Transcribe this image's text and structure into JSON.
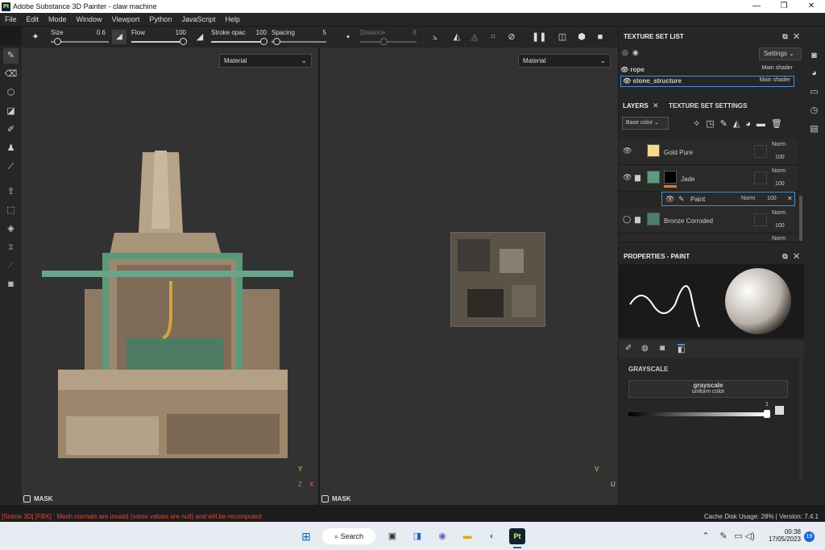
{
  "window": {
    "app_badge": "Pt",
    "title": "Adobe Substance 3D Painter - claw machine",
    "controls": [
      "—",
      "❐",
      "✕"
    ]
  },
  "menu": [
    "File",
    "Edit",
    "Mode",
    "Window",
    "Viewport",
    "Python",
    "JavaScript",
    "Help"
  ],
  "toolbar": {
    "size_label": "Size",
    "size_value": "0.6",
    "flow_label": "Flow",
    "flow_value": "100",
    "stroke_label": "Stroke opac",
    "stroke_value": "100",
    "spacing_label": "Spacing",
    "spacing_value": "5",
    "distance_label": "Distance",
    "distance_value": "8"
  },
  "viewport_3d": {
    "material_select": "Material",
    "mask_label": "MASK",
    "axis_y": "Y",
    "axis_x": "X",
    "axis_z": "Z"
  },
  "viewport_uv": {
    "material_select": "Material",
    "mask_label": "MASK",
    "axis_v": "V",
    "axis_u": "U"
  },
  "texture_set_list": {
    "title": "TEXTURE SET LIST",
    "settings_label": "Settings",
    "items": [
      {
        "name": "rope",
        "shader": "Main shader"
      },
      {
        "name": "stone_structure",
        "shader": "Main shader"
      }
    ]
  },
  "layers": {
    "tab_layers": "LAYERS",
    "tab_texture_settings": "TEXTURE SET SETTINGS",
    "channel_select": "Base color",
    "rows": [
      {
        "name": "Gold Pure",
        "blend": "Norm",
        "opacity": "100",
        "color": "#f6d98b"
      },
      {
        "name": "Jade",
        "blend": "Norm",
        "opacity": "100",
        "color": "#5b9c7b"
      },
      {
        "name": "Paint",
        "blend": "Norm",
        "opacity": "100"
      },
      {
        "name": "Bronze Corroded",
        "blend": "Norm",
        "opacity": "100",
        "color": "#4c7c6a"
      },
      {
        "name": "",
        "blend": "Norm",
        "opacity": ""
      }
    ]
  },
  "properties": {
    "title": "PROPERTIES - PAINT",
    "section": "GRAYSCALE",
    "channel_name": "grayscale",
    "channel_type": "uniform color",
    "value": "1"
  },
  "status": {
    "error": "[Scene 3D] [FBX] : Mesh normals are invalid (some values are null) and will be recomputed",
    "info": "Cache Disk Usage: 28% | Version: 7.4.1"
  },
  "taskbar": {
    "search_label": "Search",
    "time": "00:38",
    "date": "17/05/2023",
    "badge": "19"
  }
}
